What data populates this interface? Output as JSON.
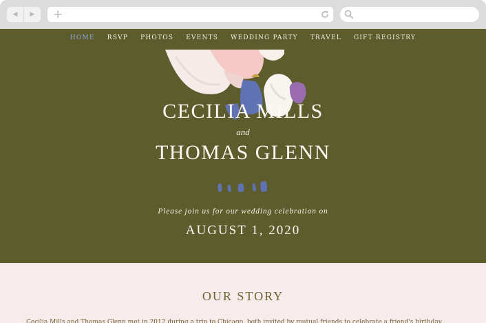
{
  "browser": {
    "back_icon": "arrow-left-icon",
    "forward_icon": "arrow-right-icon",
    "new_tab_icon": "plus-icon",
    "back_glyph": "◀",
    "forward_glyph": "▶",
    "plus_glyph": "+",
    "url_value": "",
    "search_value": ""
  },
  "nav": {
    "items": [
      "HOME",
      "RSVP",
      "PHOTOS",
      "EVENTS",
      "WEDDING PARTY",
      "TRAVEL",
      "GIFT REGISTRY"
    ],
    "active": "HOME"
  },
  "hero": {
    "name1": "CECILIA MILLS",
    "and": "and",
    "name2": "THOMAS GLENN",
    "invite": "Please join us for our wedding celebration on",
    "date": "AUGUST 1, 2020"
  },
  "story": {
    "title": "OUR STORY",
    "text": "Cecilia Mills and Thomas Glenn met in 2012 during a trip to Chicago, both invited by mutual friends to celebrate a friend's birthday."
  },
  "colors": {
    "hero_bg": "#5d5c2d",
    "story_bg": "#f8ebec",
    "active_nav": "#8fa3d6",
    "accent_blue": "#5f72b4",
    "accent_purple": "#9b6bb0",
    "accent_pink": "#f4c9c6"
  }
}
